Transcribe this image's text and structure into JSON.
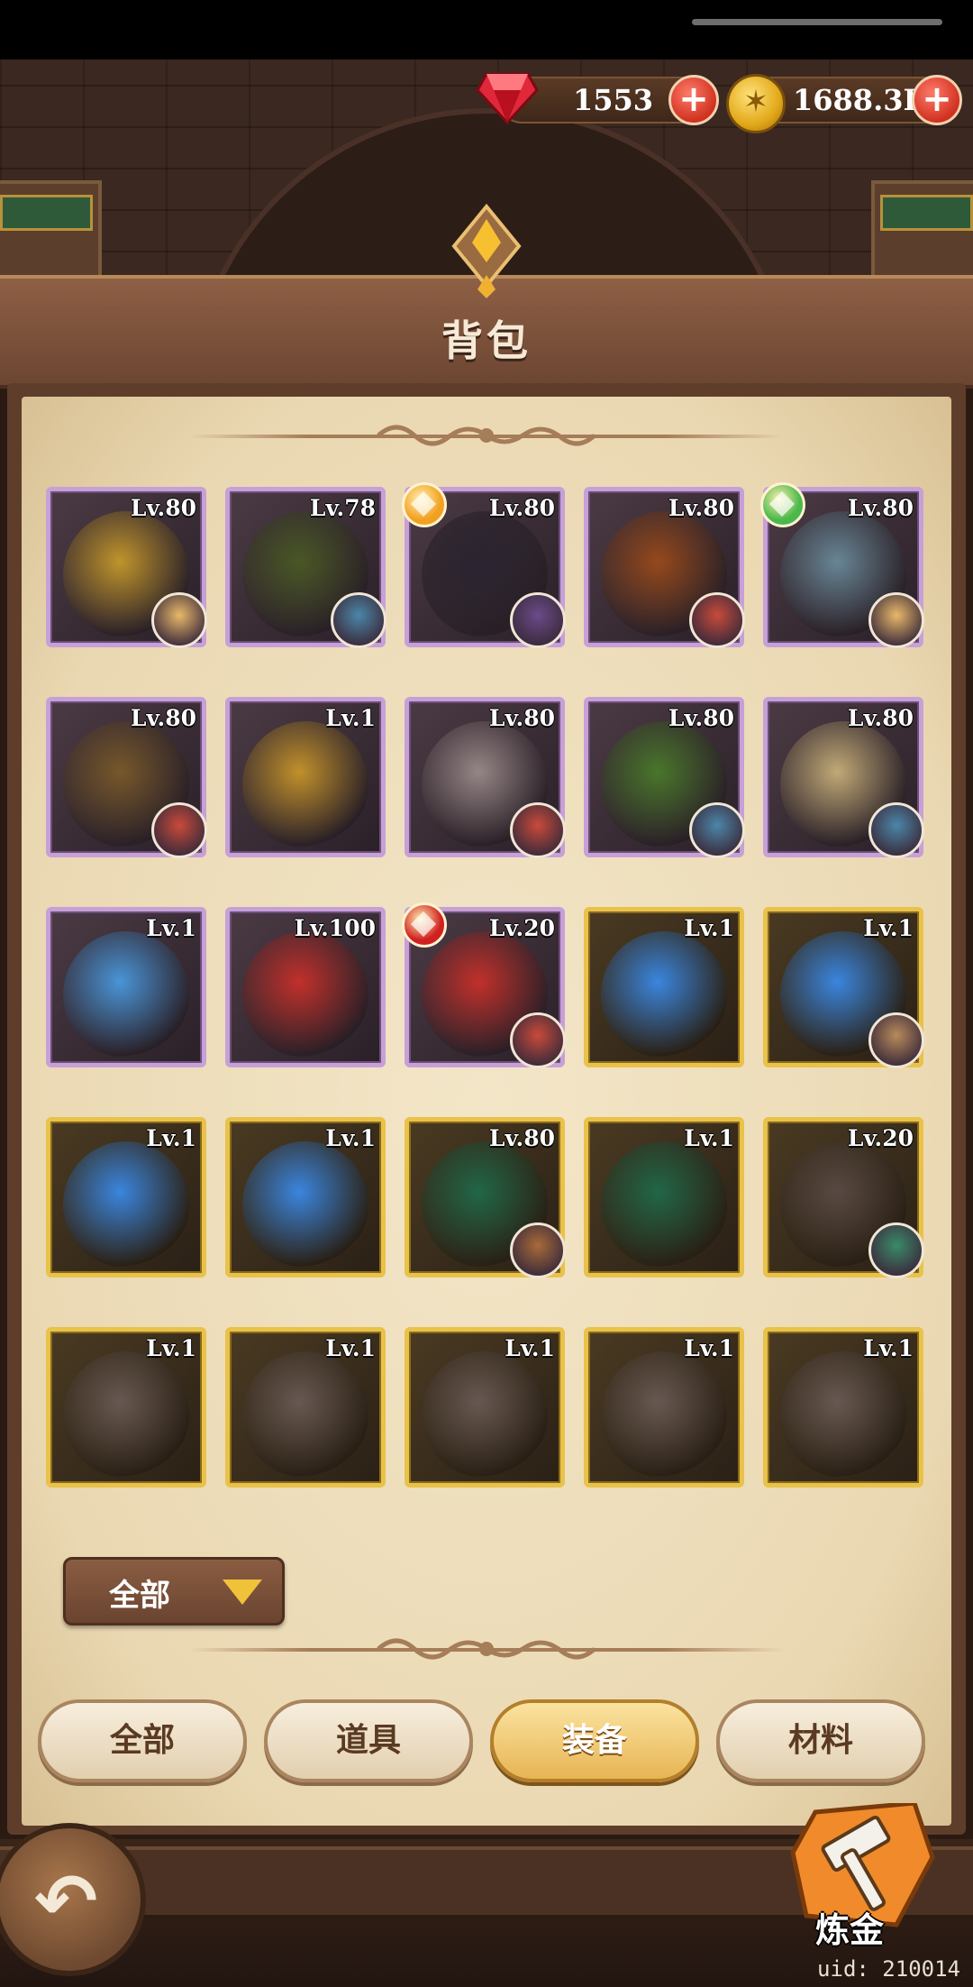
{
  "currency": {
    "gems": "1553",
    "gold": "1688.3K"
  },
  "header": {
    "title": "背包"
  },
  "items": [
    {
      "level": "Lv.80",
      "rarity": "purple",
      "art": "#c79a2b",
      "hero": "#e9b86a"
    },
    {
      "level": "Lv.78",
      "rarity": "purple",
      "art": "#4a5a24",
      "hero": "#4b86a8"
    },
    {
      "level": "Lv.80",
      "rarity": "purple",
      "art": "#2a2430",
      "hero": "#6b4a8a",
      "badge": "#f2a020"
    },
    {
      "level": "Lv.80",
      "rarity": "purple",
      "art": "#9a4a1a",
      "hero": "#c84a3a"
    },
    {
      "level": "Lv.80",
      "rarity": "purple",
      "art": "#6a8a9a",
      "hero": "#e9b86a",
      "badge": "#4ab84a"
    },
    {
      "level": "Lv.80",
      "rarity": "purple",
      "art": "#7a5a2a",
      "hero": "#c84a3a"
    },
    {
      "level": "Lv.1",
      "rarity": "purple",
      "art": "#c8962a"
    },
    {
      "level": "Lv.80",
      "rarity": "purple",
      "art": "#9a8a8a",
      "hero": "#c84a3a"
    },
    {
      "level": "Lv.80",
      "rarity": "purple",
      "art": "#4a7a2a",
      "hero": "#4b86a8"
    },
    {
      "level": "Lv.80",
      "rarity": "purple",
      "art": "#c8b07a",
      "hero": "#4b86a8"
    },
    {
      "level": "Lv.1",
      "rarity": "purple",
      "art": "#4a9ae0"
    },
    {
      "level": "Lv.100",
      "rarity": "purple",
      "art": "#c8302a"
    },
    {
      "level": "Lv.20",
      "rarity": "purple",
      "art": "#c8302a",
      "hero": "#c84a3a",
      "badge": "#d02020"
    },
    {
      "level": "Lv.1",
      "rarity": "gold",
      "art": "#3a8ae8"
    },
    {
      "level": "Lv.1",
      "rarity": "gold",
      "art": "#3a8ae8",
      "hero": "#b88a5a"
    },
    {
      "level": "Lv.1",
      "rarity": "gold",
      "art": "#3a8ae8"
    },
    {
      "level": "Lv.1",
      "rarity": "gold",
      "art": "#3a8ae8"
    },
    {
      "level": "Lv.80",
      "rarity": "gold",
      "art": "#1f6a4a",
      "hero": "#a86a3a"
    },
    {
      "level": "Lv.1",
      "rarity": "gold",
      "art": "#1f6a4a"
    },
    {
      "level": "Lv.20",
      "rarity": "gold",
      "art": "#5a4a44",
      "hero": "#3a8a6a"
    },
    {
      "level": "Lv.1",
      "rarity": "gold",
      "art": "#6a5a54"
    },
    {
      "level": "Lv.1",
      "rarity": "gold",
      "art": "#6a5a54"
    },
    {
      "level": "Lv.1",
      "rarity": "gold",
      "art": "#6a5a54"
    },
    {
      "level": "Lv.1",
      "rarity": "gold",
      "art": "#6a5a54"
    },
    {
      "level": "Lv.1",
      "rarity": "gold",
      "art": "#6a5a54"
    }
  ],
  "filter": {
    "selected": "全部"
  },
  "tabs": [
    {
      "label": "全部",
      "active": false
    },
    {
      "label": "道具",
      "active": false
    },
    {
      "label": "装备",
      "active": true
    },
    {
      "label": "材料",
      "active": false
    }
  ],
  "alchemy": {
    "label": "炼金"
  },
  "uid": "uid: 210014",
  "colors": {
    "accent": "#e7b554",
    "purple_frame": "#c7a0d8",
    "gold_frame": "#e9c24a"
  }
}
